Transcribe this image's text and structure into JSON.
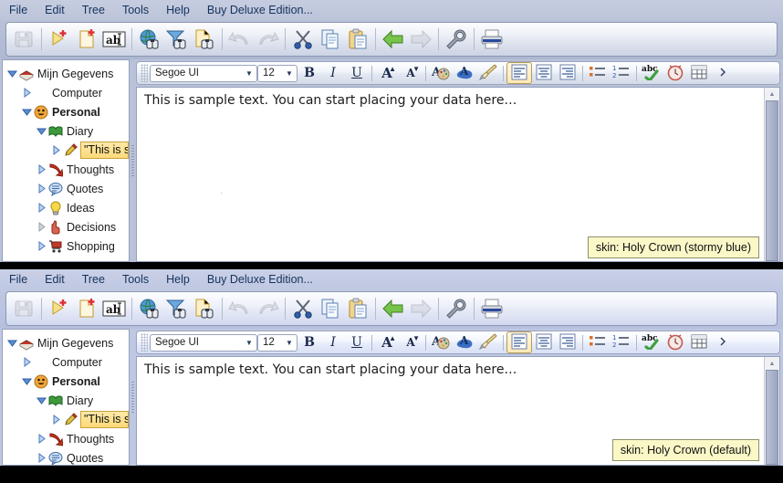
{
  "menu": {
    "items": [
      "File",
      "Edit",
      "Tree",
      "Tools",
      "Help",
      "Buy Deluxe Edition..."
    ]
  },
  "toolbar": {
    "buttons": [
      {
        "name": "save-button",
        "icon": "floppy-disk-icon",
        "label": "Save",
        "enabled": false
      },
      {
        "name": "new-node-button",
        "icon": "new-node-icon",
        "label": "New Node",
        "enabled": true
      },
      {
        "name": "new-document-button",
        "icon": "new-document-icon",
        "label": "New Document",
        "enabled": true
      },
      {
        "name": "rename-button",
        "icon": "abc-textbox-icon",
        "label": "Rename",
        "enabled": true
      },
      {
        "name": "search-web-button",
        "icon": "globe-binoculars-icon",
        "label": "Search Web",
        "enabled": true
      },
      {
        "name": "filter-search-button",
        "icon": "funnel-binoculars-icon",
        "label": "Filter",
        "enabled": true
      },
      {
        "name": "search-document-button",
        "icon": "document-binoculars-icon",
        "label": "Find in Document",
        "enabled": true
      },
      {
        "name": "undo-button",
        "icon": "undo-arrow-icon",
        "label": "Undo",
        "enabled": false
      },
      {
        "name": "redo-button",
        "icon": "redo-arrow-icon",
        "label": "Redo",
        "enabled": false
      },
      {
        "name": "cut-button",
        "icon": "scissors-icon",
        "label": "Cut",
        "enabled": true
      },
      {
        "name": "copy-button",
        "icon": "copy-pages-icon",
        "label": "Copy",
        "enabled": true
      },
      {
        "name": "paste-button",
        "icon": "clipboard-icon",
        "label": "Paste",
        "enabled": true
      },
      {
        "name": "back-button",
        "icon": "green-left-arrow-icon",
        "label": "Back",
        "enabled": true
      },
      {
        "name": "forward-button",
        "icon": "grey-right-arrow-icon",
        "label": "Forward",
        "enabled": false
      },
      {
        "name": "options-button",
        "icon": "wrench-icon",
        "label": "Options",
        "enabled": true
      },
      {
        "name": "print-button",
        "icon": "printer-icon",
        "label": "Print",
        "enabled": true
      }
    ]
  },
  "tree": {
    "nodes": [
      {
        "label": "Mijn Gegevens",
        "icon": "books-stack-icon",
        "depth": 0,
        "expanded": true,
        "bold": false,
        "selected": false
      },
      {
        "label": "Computer",
        "icon": "none",
        "depth": 1,
        "expanded": false,
        "bold": false,
        "selected": false
      },
      {
        "label": "Personal",
        "icon": "smiley-face-icon",
        "depth": 1,
        "expanded": true,
        "bold": true,
        "selected": false
      },
      {
        "label": "Diary",
        "icon": "green-book-icon",
        "depth": 2,
        "expanded": true,
        "bold": false,
        "selected": false
      },
      {
        "label": "\"This is sar",
        "icon": "pencil-icon",
        "depth": 3,
        "expanded": false,
        "bold": false,
        "selected": true
      },
      {
        "label": "Thoughts",
        "icon": "red-arrow-icon",
        "depth": 2,
        "expanded": false,
        "bold": false,
        "selected": false
      },
      {
        "label": "Quotes",
        "icon": "speech-bubble-icon",
        "depth": 2,
        "expanded": false,
        "bold": false,
        "selected": false
      },
      {
        "label": "Ideas",
        "icon": "lightbulb-icon",
        "depth": 2,
        "expanded": false,
        "bold": false,
        "selected": false
      },
      {
        "label": "Decisions",
        "icon": "pointing-hand-icon",
        "depth": 2,
        "expanded": false,
        "bold": false,
        "selected": false
      },
      {
        "label": "Shopping",
        "icon": "shopping-cart-icon",
        "depth": 2,
        "expanded": false,
        "bold": false,
        "selected": false
      }
    ]
  },
  "format_bar": {
    "font_name": "Segoe UI",
    "font_size": "12",
    "bold_label": "B",
    "italic_label": "I",
    "underline_label": "U",
    "grow_font_label": "A",
    "shrink_font_label": "A",
    "buttons": [
      {
        "name": "font-color-button",
        "icon": "font-color-palette-icon"
      },
      {
        "name": "highlight-button",
        "icon": "highlight-blob-icon"
      },
      {
        "name": "clear-formatting-button",
        "icon": "paintbrush-icon"
      },
      {
        "name": "align-left-button",
        "icon": "align-left-icon",
        "active": true
      },
      {
        "name": "align-center-button",
        "icon": "align-center-icon",
        "active": false
      },
      {
        "name": "align-right-button",
        "icon": "align-right-icon",
        "active": false
      },
      {
        "name": "bullet-list-button",
        "icon": "bullet-list-icon"
      },
      {
        "name": "numbered-list-button",
        "icon": "numbered-list-icon"
      },
      {
        "name": "spellcheck-button",
        "icon": "abc-check-icon"
      },
      {
        "name": "insert-time-button",
        "icon": "alarm-clock-icon"
      },
      {
        "name": "insert-table-button",
        "icon": "table-grid-icon"
      },
      {
        "name": "overflow-button",
        "icon": "chevron-right-icon"
      }
    ]
  },
  "editor": {
    "text": "This is sample text. You can start placing your data here…"
  },
  "tooltips": {
    "top": "skin: Holy Crown (stormy blue)",
    "bottom": "skin: Holy Crown (default)"
  },
  "colors": {
    "top_skin_menubar": "#c2c9dd",
    "bottom_skin_menubar": "#c5cce4",
    "selection": "#fdd978",
    "tooltip_bg": "#fbf8c8",
    "menu_text": "#14325c"
  }
}
